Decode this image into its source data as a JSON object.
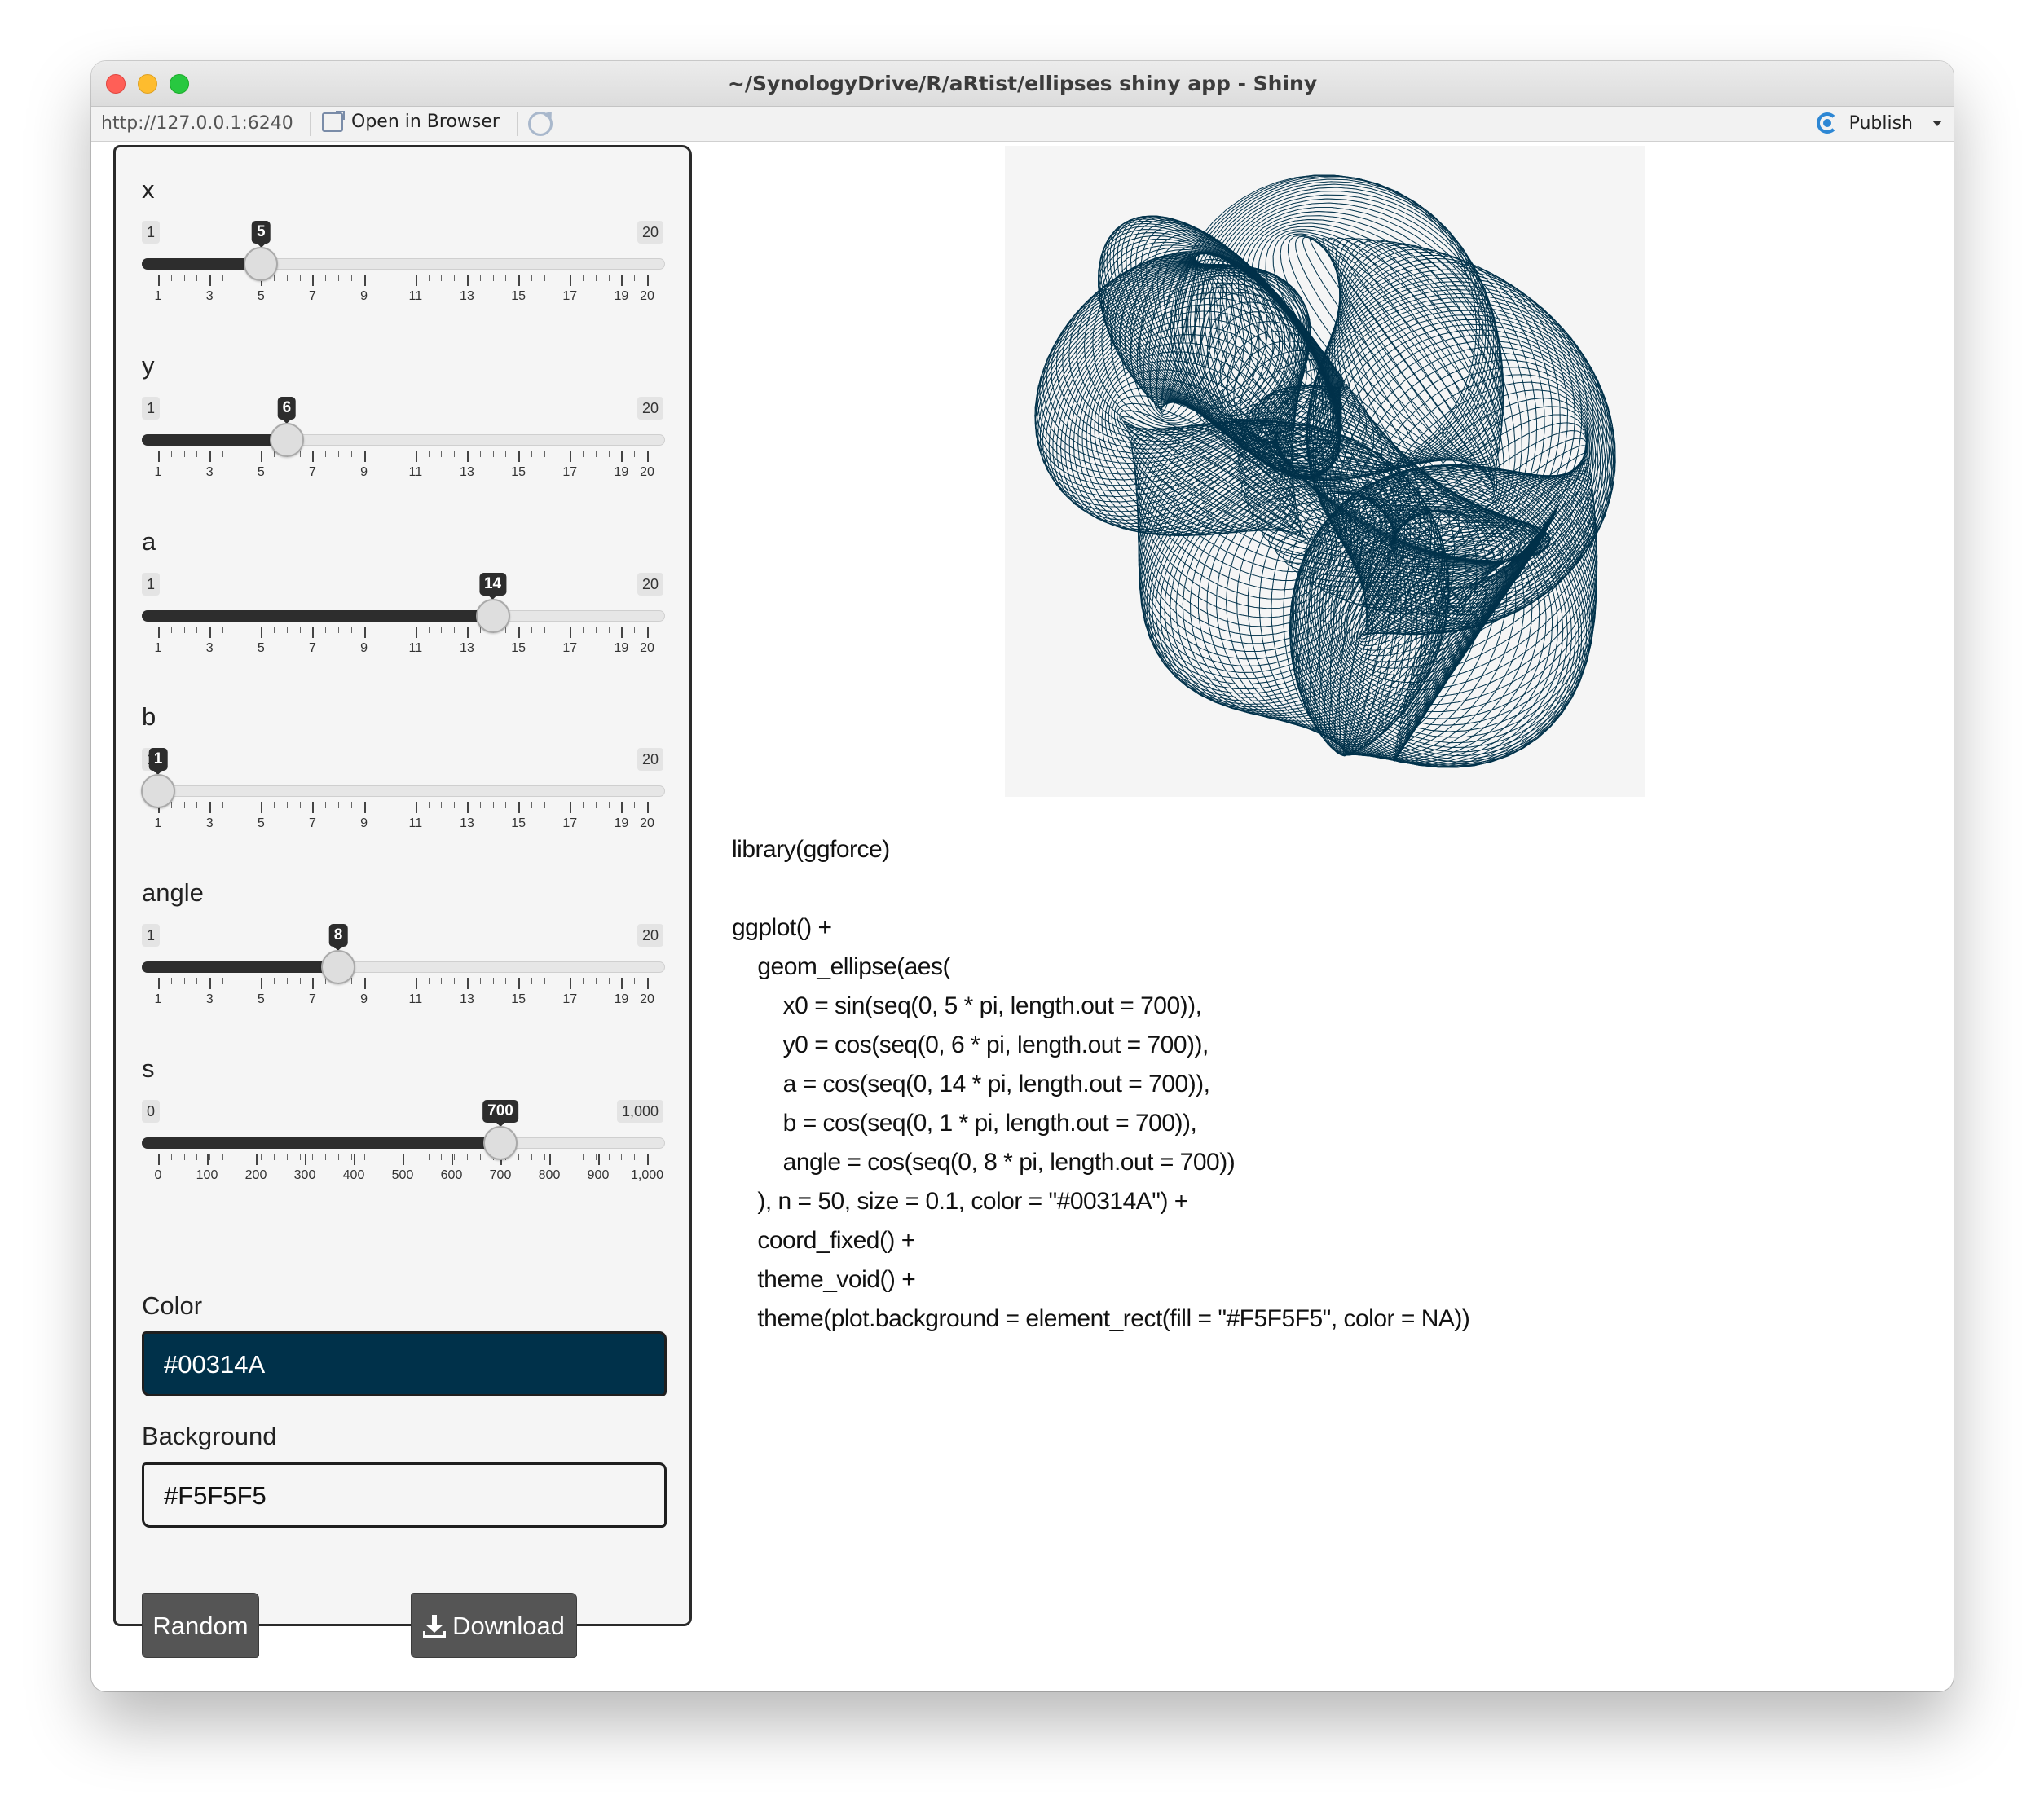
{
  "window": {
    "title": "~/SynologyDrive/R/aRtist/ellipses shiny app - Shiny"
  },
  "toolbar": {
    "url": "http://127.0.0.1:6240",
    "open_in_browser": "Open in Browser",
    "publish": "Publish"
  },
  "sliders": [
    {
      "label": "x",
      "min": 1,
      "max": 20,
      "min_label": "1",
      "max_label": "20",
      "value": 5,
      "value_label": "5",
      "ticks": [
        1,
        3,
        5,
        7,
        9,
        11,
        13,
        15,
        17,
        19,
        20
      ],
      "tick_labels": [
        "1",
        "3",
        "5",
        "7",
        "9",
        "11",
        "13",
        "15",
        "17",
        "19",
        "20"
      ]
    },
    {
      "label": "y",
      "min": 1,
      "max": 20,
      "min_label": "1",
      "max_label": "20",
      "value": 6,
      "value_label": "6",
      "ticks": [
        1,
        3,
        5,
        7,
        9,
        11,
        13,
        15,
        17,
        19,
        20
      ],
      "tick_labels": [
        "1",
        "3",
        "5",
        "7",
        "9",
        "11",
        "13",
        "15",
        "17",
        "19",
        "20"
      ]
    },
    {
      "label": "a",
      "min": 1,
      "max": 20,
      "min_label": "1",
      "max_label": "20",
      "value": 14,
      "value_label": "14",
      "ticks": [
        1,
        3,
        5,
        7,
        9,
        11,
        13,
        15,
        17,
        19,
        20
      ],
      "tick_labels": [
        "1",
        "3",
        "5",
        "7",
        "9",
        "11",
        "13",
        "15",
        "17",
        "19",
        "20"
      ]
    },
    {
      "label": "b",
      "min": 1,
      "max": 20,
      "min_label": "1",
      "max_label": "20",
      "value": 1,
      "value_label": "1",
      "ticks": [
        1,
        3,
        5,
        7,
        9,
        11,
        13,
        15,
        17,
        19,
        20
      ],
      "tick_labels": [
        "1",
        "3",
        "5",
        "7",
        "9",
        "11",
        "13",
        "15",
        "17",
        "19",
        "20"
      ]
    },
    {
      "label": "angle",
      "min": 1,
      "max": 20,
      "min_label": "1",
      "max_label": "20",
      "value": 8,
      "value_label": "8",
      "ticks": [
        1,
        3,
        5,
        7,
        9,
        11,
        13,
        15,
        17,
        19,
        20
      ],
      "tick_labels": [
        "1",
        "3",
        "5",
        "7",
        "9",
        "11",
        "13",
        "15",
        "17",
        "19",
        "20"
      ]
    },
    {
      "label": "s",
      "min": 0,
      "max": 1000,
      "min_label": "0",
      "max_label": "1,000",
      "value": 700,
      "value_label": "700",
      "ticks": [
        0,
        100,
        200,
        300,
        400,
        500,
        600,
        700,
        800,
        900,
        1000
      ],
      "tick_labels": [
        "0",
        "100",
        "200",
        "300",
        "400",
        "500",
        "600",
        "700",
        "800",
        "900",
        "1,000"
      ]
    }
  ],
  "color_field": {
    "label": "Color",
    "value": "#00314A"
  },
  "background_field": {
    "label": "Background",
    "value": "#F5F5F5"
  },
  "buttons": {
    "random": "Random",
    "download": "Download"
  },
  "code_lines": [
    "library(ggforce)",
    "",
    "ggplot() +",
    "    geom_ellipse(aes(",
    "        x0 = sin(seq(0, 5 * pi, length.out = 700)),",
    "        y0 = cos(seq(0, 6 * pi, length.out = 700)),",
    "        a = cos(seq(0, 14 * pi, length.out = 700)),",
    "        b = cos(seq(0, 1 * pi, length.out = 700)),",
    "        angle = cos(seq(0, 8 * pi, length.out = 700))",
    "    ), n = 50, size = 0.1, color = \"#00314A\") +",
    "    coord_fixed() +",
    "    theme_void() +",
    "    theme(plot.background = element_rect(fill = \"#F5F5F5\", color = NA))"
  ],
  "colors": {
    "stroke": "#00314A",
    "plot_background": "#F5F5F5",
    "slider_fill": "#2d2d2d",
    "button": "#555555",
    "publish_icon": "#2d87d4"
  },
  "icons": [
    "open-in-browser-icon",
    "refresh-icon",
    "publish-icon",
    "dropdown-caret-icon",
    "download-icon"
  ]
}
